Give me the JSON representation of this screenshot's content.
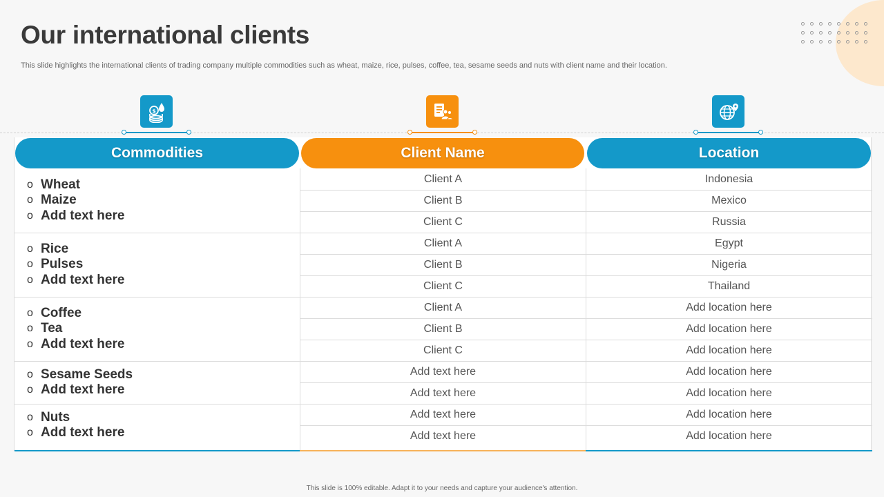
{
  "slide": {
    "title": "Our international clients",
    "subtitle": "This slide highlights the international clients of trading company multiple commodities such as wheat, maize, rice, pulses, coffee, tea,  sesame seeds and nuts with client name and their location.",
    "footer": "This slide is 100% editable.  Adapt it to your needs and capture your audience's attention."
  },
  "icons": [
    {
      "name": "coins-drop-icon",
      "color": "#1499c9"
    },
    {
      "name": "client-document-people-icon",
      "color": "#f7900e"
    },
    {
      "name": "globe-location-icon",
      "color": "#1499c9"
    }
  ],
  "headers": {
    "commodities": "Commodities",
    "client_name": "Client Name",
    "location": "Location"
  },
  "groups": [
    {
      "items": [
        "Wheat",
        "Maize",
        "Add text here"
      ]
    },
    {
      "items": [
        "Rice",
        "Pulses",
        "Add text here"
      ]
    },
    {
      "items": [
        "Coffee",
        "Tea",
        "Add text here"
      ]
    },
    {
      "items": [
        "Sesame Seeds",
        "Add text here"
      ]
    },
    {
      "items": [
        "Nuts",
        "Add text here"
      ]
    }
  ],
  "rows": [
    {
      "client": "Client A",
      "location": "Indonesia"
    },
    {
      "client": "Client B",
      "location": "Mexico"
    },
    {
      "client": "Client C",
      "location": "Russia"
    },
    {
      "client": "Client A",
      "location": "Egypt"
    },
    {
      "client": "Client B",
      "location": "Nigeria"
    },
    {
      "client": "Client C",
      "location": "Thailand"
    },
    {
      "client": "Client A",
      "location": "Add location here"
    },
    {
      "client": "Client B",
      "location": "Add location here"
    },
    {
      "client": "Client C",
      "location": "Add location here"
    },
    {
      "client": "Add text here",
      "location": "Add location here"
    },
    {
      "client": "Add text here",
      "location": "Add location here"
    },
    {
      "client": "Add text here",
      "location": "Add location here"
    },
    {
      "client": "Add text here",
      "location": "Add location here"
    }
  ],
  "colors": {
    "blue": "#1499c9",
    "orange": "#f7900e",
    "deco": "#fde8cd"
  }
}
